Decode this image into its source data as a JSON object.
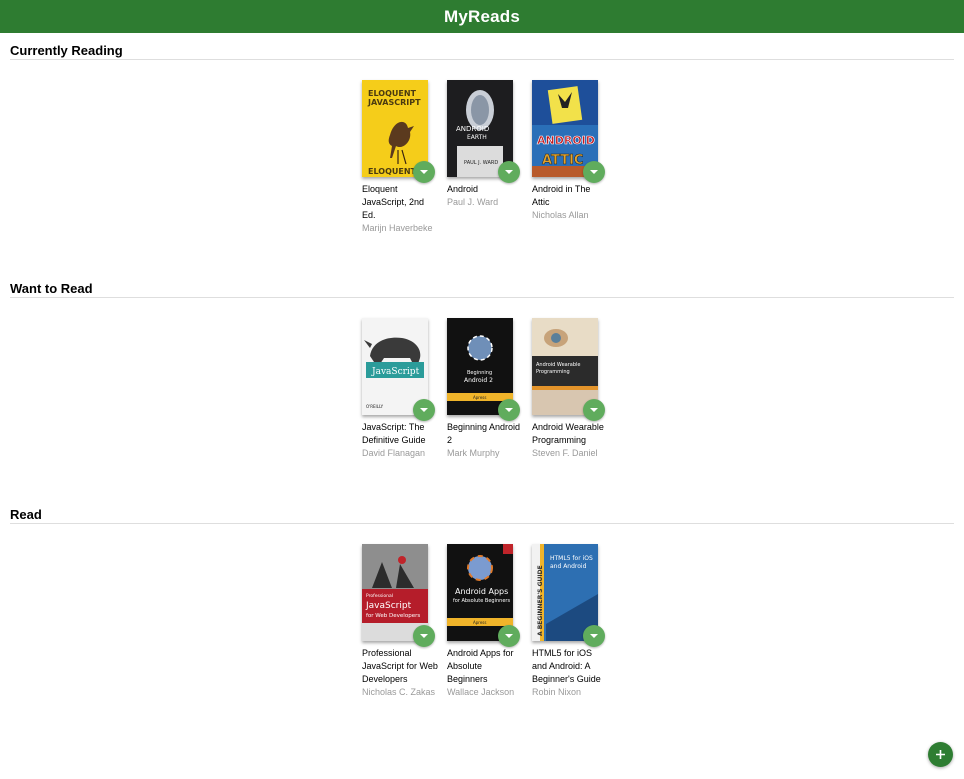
{
  "app": {
    "title": "MyReads"
  },
  "colors": {
    "header": "#2e7c31",
    "changer": "#60ac5d",
    "search_button": "#2e7d32"
  },
  "shelves": [
    {
      "title": "Currently Reading",
      "books": [
        {
          "title": "Eloquent JavaScript, 2nd Ed.",
          "authors": "Marijn Haverbeke",
          "cover_text": [
            "ELOQUENT",
            "JAVASCRIPT",
            "ELOQUENT"
          ]
        },
        {
          "title": "Android",
          "authors": "Paul J. Ward",
          "cover_text": [
            "ANDROID",
            "EARTH",
            "PAUL J. WARD"
          ]
        },
        {
          "title": "Android in The Attic",
          "authors": "Nicholas Allan",
          "cover_text": [
            "ANDROID",
            "ATTIC"
          ]
        }
      ]
    },
    {
      "title": "Want to Read",
      "books": [
        {
          "title": "JavaScript: The Definitive Guide",
          "authors": "David Flanagan",
          "cover_text": [
            "JavaScript",
            "O'REILLY"
          ]
        },
        {
          "title": "Beginning Android 2",
          "authors": "Mark Murphy",
          "cover_text": [
            "Beginning",
            "Android 2",
            "Apress"
          ]
        },
        {
          "title": "Android Wearable Programming",
          "authors": "Steven F. Daniel",
          "cover_text": [
            "Android Wearable",
            "Programming"
          ]
        }
      ]
    },
    {
      "title": "Read",
      "books": [
        {
          "title": "Professional JavaScript for Web Developers",
          "authors": "Nicholas C. Zakas",
          "cover_text": [
            "Professional",
            "JavaScript",
            "for Web Developers"
          ]
        },
        {
          "title": "Android Apps for Absolute Beginners",
          "authors": "Wallace Jackson",
          "cover_text": [
            "Android Apps",
            "for Absolute Beginners",
            "Apress"
          ]
        },
        {
          "title": "HTML5 for iOS and Android: A Beginner's Guide",
          "authors": "Robin Nixon",
          "cover_text": [
            "HTML5 for iOS",
            "and Android",
            "A BEGINNER'S GUIDE"
          ]
        }
      ]
    }
  ],
  "search_button": {
    "icon": "add-icon"
  }
}
